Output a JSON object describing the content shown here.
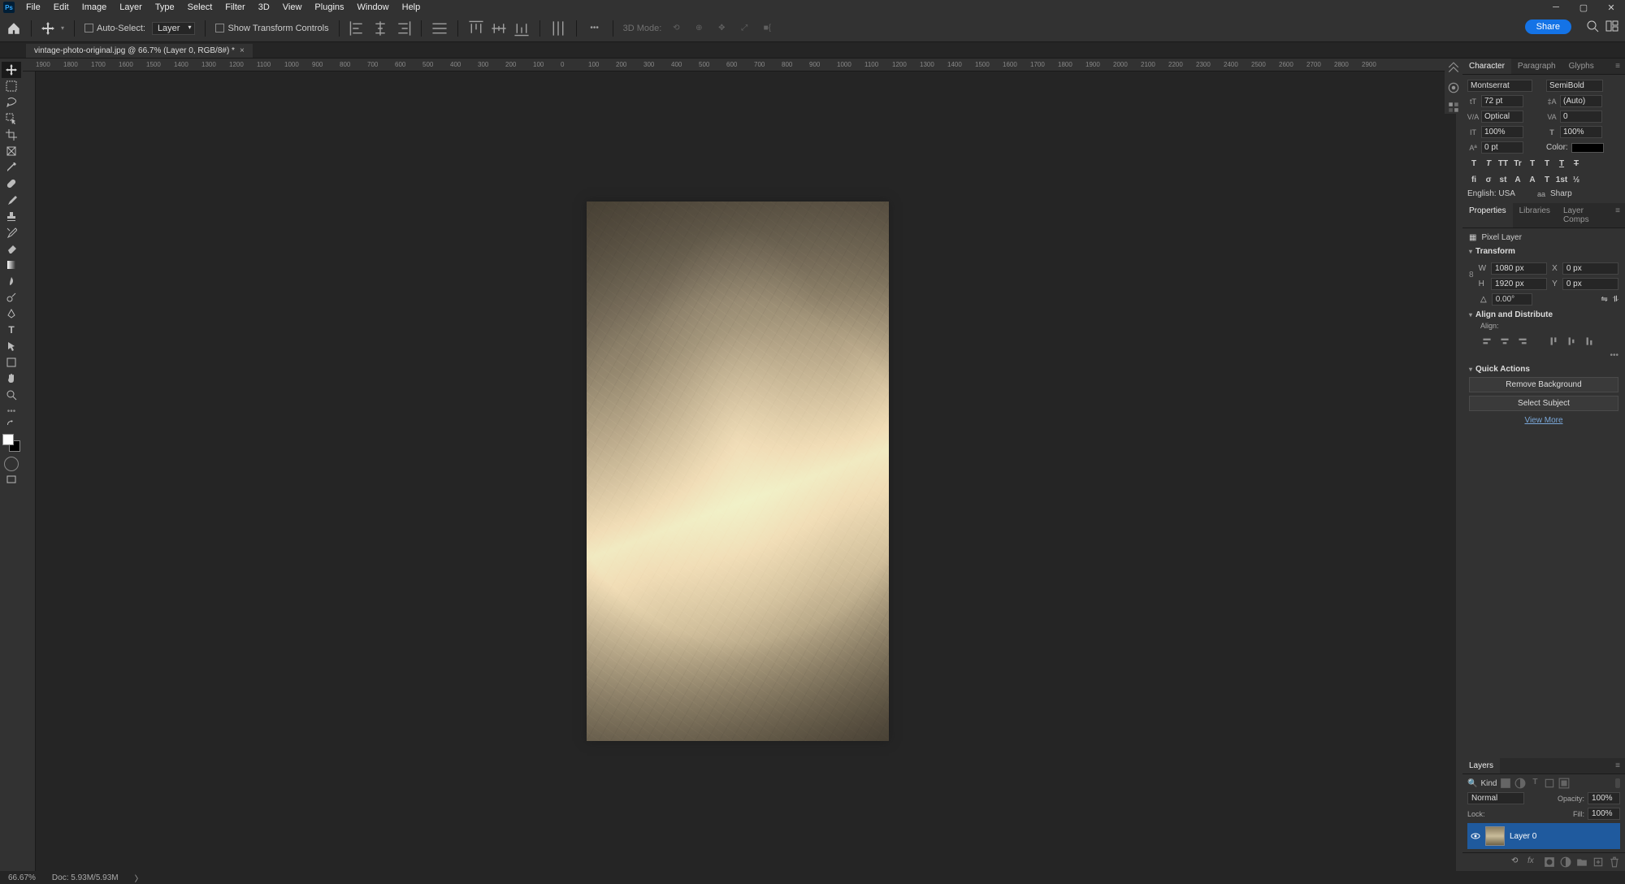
{
  "menu": [
    "File",
    "Edit",
    "Image",
    "Layer",
    "Type",
    "Select",
    "Filter",
    "3D",
    "View",
    "Plugins",
    "Window",
    "Help"
  ],
  "optbar": {
    "autoSelect": "Auto-Select:",
    "autoSelectTarget": "Layer",
    "showTransform": "Show Transform Controls",
    "mode3d": "3D Mode:"
  },
  "share": "Share",
  "docTab": "vintage-photo-original.jpg @ 66.7% (Layer 0, RGB/8#) *",
  "rulerH": [
    "1900",
    "1800",
    "1700",
    "1600",
    "1500",
    "1400",
    "1300",
    "1200",
    "1100",
    "1000",
    "900",
    "800",
    "700",
    "600",
    "500",
    "400",
    "300",
    "200",
    "100",
    "0",
    "100",
    "200",
    "300",
    "400",
    "500",
    "600",
    "700",
    "800",
    "900",
    "1000",
    "1100",
    "1200",
    "1300",
    "1400",
    "1500",
    "1600",
    "1700",
    "1800",
    "1900",
    "2000",
    "2100",
    "2200",
    "2300",
    "2400",
    "2500",
    "2600",
    "2700",
    "2800",
    "2900"
  ],
  "character": {
    "tabs": [
      "Character",
      "Paragraph",
      "Glyphs"
    ],
    "font": "Montserrat",
    "style": "SemiBold",
    "size": "72 pt",
    "leading": "(Auto)",
    "kerning": "Optical",
    "tracking": "0",
    "vscale": "100%",
    "hscale": "100%",
    "baseline": "0 pt",
    "colorLabel": "Color:",
    "lang": "English: USA",
    "aa": "Sharp",
    "aaLabel": "aa",
    "styleBtns": [
      "T",
      "T",
      "TT",
      "Tr",
      "T",
      "T",
      "T",
      "T"
    ],
    "otBtns": [
      "fi",
      "σ",
      "st",
      "A",
      "A",
      "T",
      "1st",
      "½"
    ]
  },
  "properties": {
    "tabs": [
      "Properties",
      "Libraries",
      "Layer Comps"
    ],
    "pixelLayer": "Pixel Layer",
    "transform": "Transform",
    "W": "1080 px",
    "X": "0 px",
    "H": "1920 px",
    "Y": "0 px",
    "angle": "0.00°",
    "labels": {
      "W": "W",
      "X": "X",
      "H": "H",
      "Y": "Y"
    },
    "align": "Align and Distribute",
    "alignLabel": "Align:",
    "quick": "Quick Actions",
    "removeBg": "Remove Background",
    "selectSubj": "Select Subject",
    "viewMore": "View More"
  },
  "layers": {
    "tab": "Layers",
    "kind": "Kind",
    "blend": "Normal",
    "opacityLabel": "Opacity:",
    "opacity": "100%",
    "lockLabel": "Lock:",
    "fillLabel": "Fill:",
    "fill": "100%",
    "layerName": "Layer 0"
  },
  "status": {
    "zoom": "66.67%",
    "doc": "Doc: 5.93M/5.93M"
  }
}
